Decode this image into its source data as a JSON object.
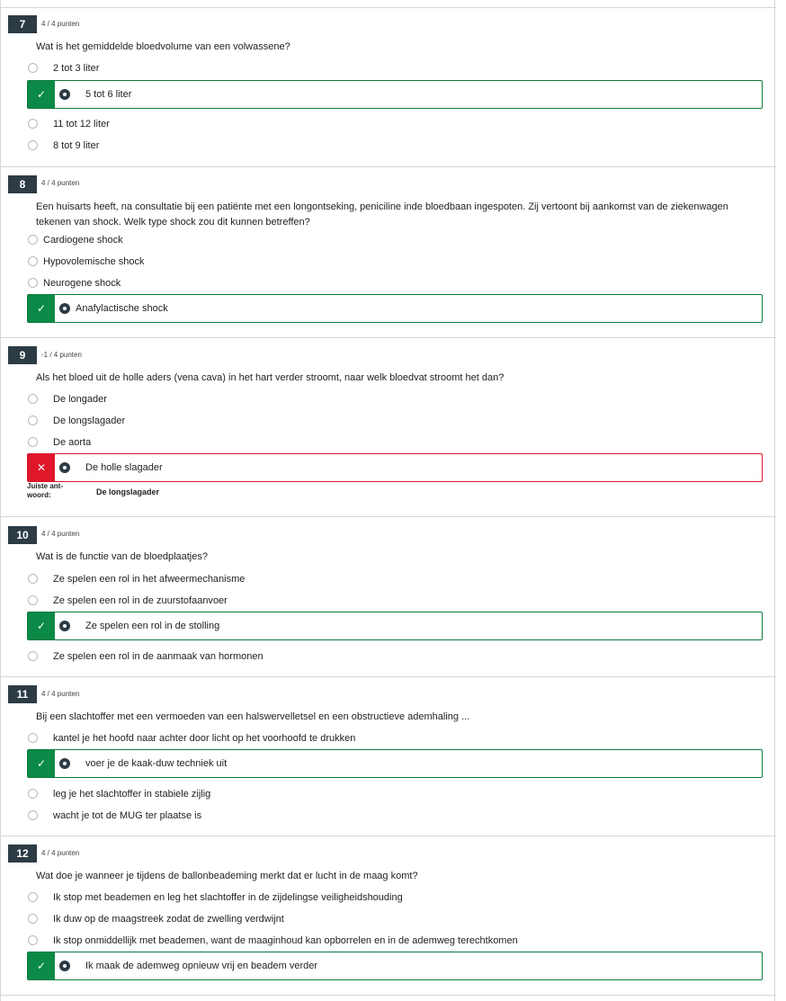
{
  "questions": [
    {
      "number": "7",
      "points": "4 / 4 punten",
      "text": "Wat is het gemiddelde bloedvolume van een volwassene?",
      "options": [
        "2 tot 3 liter",
        "5 tot 6 liter",
        "11 tot 12 liter",
        "8 tot 9 liter"
      ],
      "selected_index": 1,
      "result": "correct"
    },
    {
      "number": "8",
      "points": "4 / 4 punten",
      "text": "Een huisarts heeft, na consultatie bij een patiënte met een longontseking, peniciline inde bloedbaan ingespoten. Zij vertoont bij aankomst van de ziekenwagen tekenen van shock. Welk type shock zou dit kunnen betreffen?",
      "options": [
        "Cardiogene shock",
        "Hypovolemische shock",
        "Neurogene shock",
        "Anafylactische shock"
      ],
      "selected_index": 3,
      "result": "correct"
    },
    {
      "number": "9",
      "points": "-1 / 4 punten",
      "text": "Als het bloed uit de holle aders (vena cava) in het hart verder stroomt, naar welk bloedvat stroomt het dan?",
      "options": [
        "De longader",
        "De longslagader",
        "De aorta",
        "De holle slagader"
      ],
      "selected_index": 3,
      "result": "incorrect",
      "correct_answer_label": "Juiste ant-woord:",
      "correct_answer_value": "De longslagader"
    },
    {
      "number": "10",
      "points": "4 / 4 punten",
      "text": "Wat is de functie van de bloedplaatjes?",
      "options": [
        "Ze spelen een rol in het afweermechanisme",
        "Ze spelen een rol in de zuurstofaanvoer",
        "Ze spelen een rol in de stolling",
        "Ze spelen een rol in de aanmaak van hormonen"
      ],
      "selected_index": 2,
      "result": "correct"
    },
    {
      "number": "11",
      "points": "4 / 4 punten",
      "text": "Bij een slachtoffer met een vermoeden van een halswervelletsel en een obstructieve ademhaling ...",
      "options": [
        "kantel je het hoofd naar achter door licht op het voorhoofd te drukken",
        "voer je de kaak-duw techniek uit",
        "leg je het slachtoffer in stabiele zijlig",
        "wacht je tot de MUG ter plaatse is"
      ],
      "selected_index": 1,
      "result": "correct"
    },
    {
      "number": "12",
      "points": "4 / 4 punten",
      "text": "Wat doe je wanneer je tijdens de ballonbeademing merkt dat er lucht in de maag komt?",
      "options": [
        "Ik stop met beademen en leg het slachtoffer in de zijdelingse veiligheidshouding",
        "Ik duw op de maagstreek zodat de zwelling verdwijnt",
        "Ik stop onmiddellijk met beademen, want de maaginhoud kan opborrelen en in de ademweg terechtkomen",
        "Ik maak de ademweg opnieuw vrij en beadem verder"
      ],
      "selected_index": 3,
      "result": "correct"
    }
  ],
  "icons": {
    "correct": "check-icon",
    "incorrect": "x-icon",
    "correct_glyph": "✓",
    "incorrect_glyph": "✕"
  },
  "colors": {
    "correct": "#0b8a47",
    "incorrect": "#e0162b",
    "badge": "#2d3b45"
  }
}
